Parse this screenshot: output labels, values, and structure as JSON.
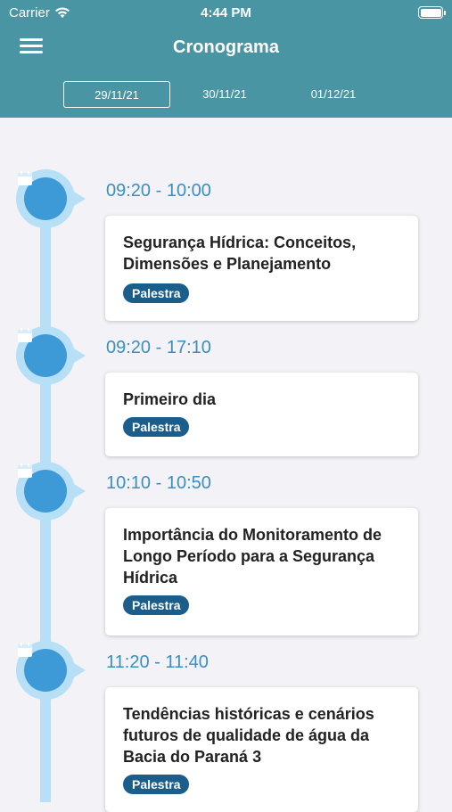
{
  "status": {
    "carrier": "Carrier",
    "time": "4:44 PM"
  },
  "header": {
    "title": "Cronograma",
    "menu_icon": "hamburger-menu-icon"
  },
  "dates": [
    "29/11/21",
    "30/11/21",
    "01/12/21"
  ],
  "selected_date": "29/11/21",
  "colors": {
    "header": "#4a95a3",
    "accent": "#3a8fc2",
    "tag": "#1b5e8c",
    "timeline": "#b7dff6"
  },
  "schedule": [
    {
      "time": "09:20 - 10:00",
      "title": "Segurança Hídrica: Conceitos, Dimensões e Planejamento",
      "tag": "Palestra"
    },
    {
      "time": "09:20 - 17:10",
      "title": "Primeiro dia",
      "tag": "Palestra"
    },
    {
      "time": "10:10 - 10:50",
      "title": "Importância do Monitoramento de Longo Período para a Segurança Hídrica",
      "tag": "Palestra"
    },
    {
      "time": "11:20 - 11:40",
      "title": "Tendências históricas e cenários futuros de qualidade de água da Bacia do Paraná 3",
      "tag": "Palestra"
    }
  ]
}
